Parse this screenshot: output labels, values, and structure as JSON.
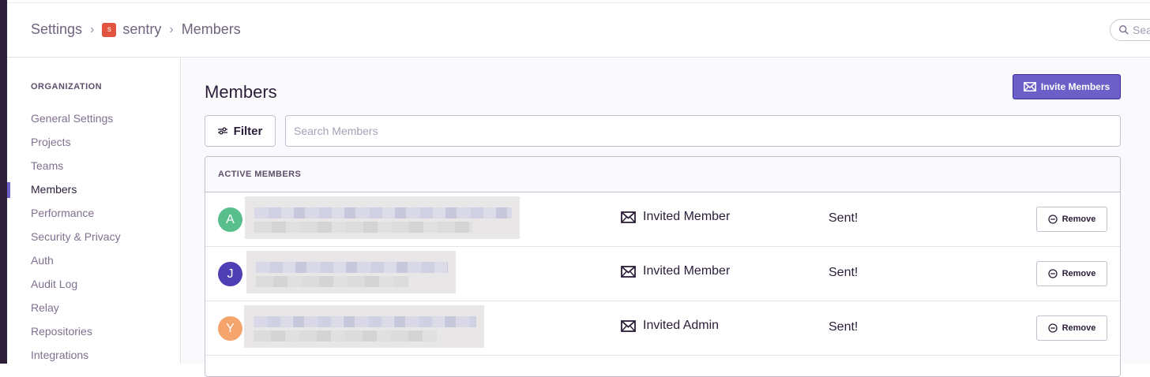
{
  "breadcrumb": {
    "settings": "Settings",
    "org_initial": "s",
    "org_name": "sentry",
    "current": "Members"
  },
  "top_search": {
    "placeholder": "Sea"
  },
  "sidebar": {
    "heading": "ORGANIZATION",
    "items": [
      {
        "label": "General Settings"
      },
      {
        "label": "Projects"
      },
      {
        "label": "Teams"
      },
      {
        "label": "Members",
        "active": true
      },
      {
        "label": "Performance"
      },
      {
        "label": "Security & Privacy"
      },
      {
        "label": "Auth"
      },
      {
        "label": "Audit Log"
      },
      {
        "label": "Relay"
      },
      {
        "label": "Repositories"
      },
      {
        "label": "Integrations"
      }
    ]
  },
  "main": {
    "title": "Members",
    "invite_label": "Invite Members",
    "filter_label": "Filter",
    "search_placeholder": "Search Members"
  },
  "members": {
    "heading": "ACTIVE MEMBERS",
    "rows": [
      {
        "initial": "A",
        "avatar_color": "#57be8c",
        "role": "Invited Member",
        "status": "Sent!",
        "remove_label": "Remove"
      },
      {
        "initial": "J",
        "avatar_color": "#4e3fb4",
        "role": "Invited Member",
        "status": "Sent!",
        "remove_label": "Remove"
      },
      {
        "initial": "Y",
        "avatar_color": "#f5a46b",
        "role": "Invited Admin",
        "status": "Sent!",
        "remove_label": "Remove"
      }
    ]
  },
  "colors": {
    "accent": "#6c5fc7",
    "sidebar_strip": "#2f1e3a",
    "org_badge": "#e1543f"
  },
  "icons": {
    "breadcrumb_sep": "chevron-right-icon",
    "search": "search-icon",
    "invite": "mail-icon",
    "filter": "sliders-icon",
    "role": "mail-icon",
    "remove": "minus-circle-icon"
  }
}
